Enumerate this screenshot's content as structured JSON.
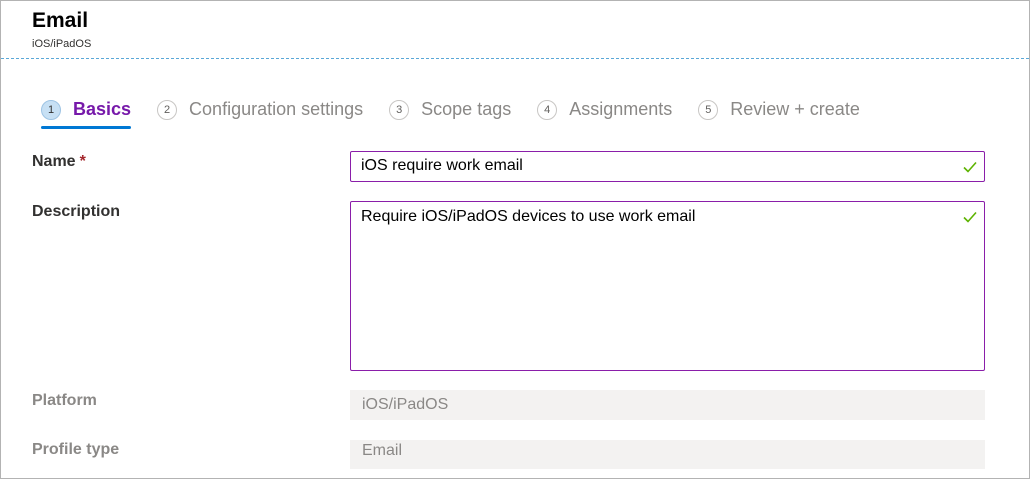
{
  "header": {
    "title": "Email",
    "subtitle": "iOS/iPadOS"
  },
  "wizard": {
    "steps": [
      {
        "num": "1",
        "label": "Basics"
      },
      {
        "num": "2",
        "label": "Configuration settings"
      },
      {
        "num": "3",
        "label": "Scope tags"
      },
      {
        "num": "4",
        "label": "Assignments"
      },
      {
        "num": "5",
        "label": "Review + create"
      }
    ],
    "active_step": "Basics"
  },
  "form": {
    "name": {
      "label": "Name",
      "required_marker": "*",
      "value": "iOS require work email"
    },
    "description": {
      "label": "Description",
      "value": "Require iOS/iPadOS devices to use work email"
    },
    "platform": {
      "label": "Platform",
      "value": "iOS/iPadOS"
    },
    "profile_type": {
      "label": "Profile type",
      "value": "Email"
    }
  },
  "colors": {
    "accent_purple": "#7719aa",
    "input_border": "#8a1ea9",
    "valid_check": "#5db300",
    "active_underline": "#0078d4"
  },
  "icons": {
    "valid": "checkmark-icon"
  }
}
